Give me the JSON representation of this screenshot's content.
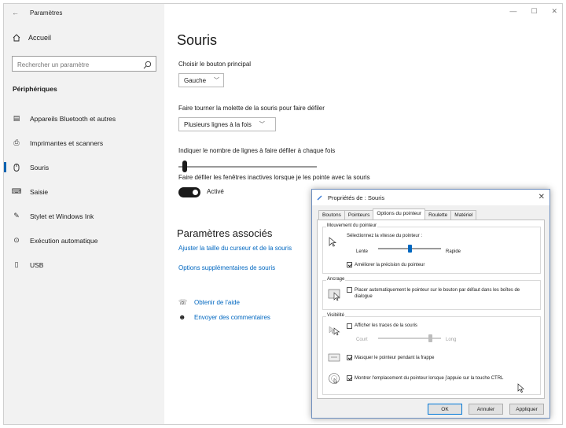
{
  "window": {
    "title": "Paramètres",
    "controls": [
      "—",
      "☐",
      "✕"
    ]
  },
  "sidebar": {
    "home_label": "Accueil",
    "search_placeholder": "Rechercher un paramètre",
    "section": "Périphériques",
    "items": [
      {
        "label": "Appareils Bluetooth et autres",
        "icon": "bluetooth-devices-icon"
      },
      {
        "label": "Imprimantes et scanners",
        "icon": "printer-icon"
      },
      {
        "label": "Souris",
        "icon": "mouse-icon"
      },
      {
        "label": "Saisie",
        "icon": "keyboard-icon"
      },
      {
        "label": "Stylet et Windows Ink",
        "icon": "pen-icon"
      },
      {
        "label": "Exécution automatique",
        "icon": "autoplay-icon"
      },
      {
        "label": "USB",
        "icon": "usb-icon"
      }
    ]
  },
  "main": {
    "title": "Souris",
    "primary_button_label": "Choisir le bouton principal",
    "primary_button_value": "Gauche",
    "scroll_label": "Faire tourner la molette de la souris pour faire défiler",
    "scroll_value": "Plusieurs lignes à la fois",
    "lines_label": "Indiquer le nombre de lignes à faire défiler à chaque fois",
    "lines_slider_level": 0.03,
    "inactive_label": "Faire défiler les fenêtres inactives lorsque je les pointe avec la souris",
    "inactive_toggle_label": "Activé",
    "related_title": "Paramètres associés",
    "related_links": [
      "Ajuster la taille du curseur et de la souris",
      "Options supplémentaires de souris"
    ],
    "help_items": [
      "Obtenir de l'aide",
      "Envoyer des commentaires"
    ]
  },
  "dialog": {
    "title": "Propriétés de : Souris",
    "tabs": [
      "Boutons",
      "Pointeurs",
      "Options du pointeur",
      "Roulette",
      "Matériel"
    ],
    "active_tab": "Options du pointeur",
    "motion": {
      "group_title": "Mouvement du pointeur",
      "speed_label": "Sélectionnez la vitesse du pointeur :",
      "slow": "Lente",
      "fast": "Rapide",
      "speed_level": 0.5,
      "precision_label": "Améliorer la précision du pointeur",
      "precision_checked": true
    },
    "snap": {
      "group_title": "Ancrage",
      "label": "Placer automatiquement le pointeur sur le bouton par défaut dans les boîtes de dialogue",
      "checked": false
    },
    "visibility": {
      "group_title": "Visibilité",
      "trails_label": "Afficher les traces de la souris",
      "trails_checked": false,
      "short": "Court",
      "long": "Long",
      "trails_level": 0.85,
      "hide_label": "Masquer le pointeur pendant la frappe",
      "hide_checked": true,
      "ctrl_label": "Montrer l'emplacement du pointeur lorsque j'appuie sur la touche CTRL",
      "ctrl_checked": true
    },
    "buttons": {
      "ok": "OK",
      "cancel": "Annuler",
      "apply": "Appliquer"
    }
  }
}
